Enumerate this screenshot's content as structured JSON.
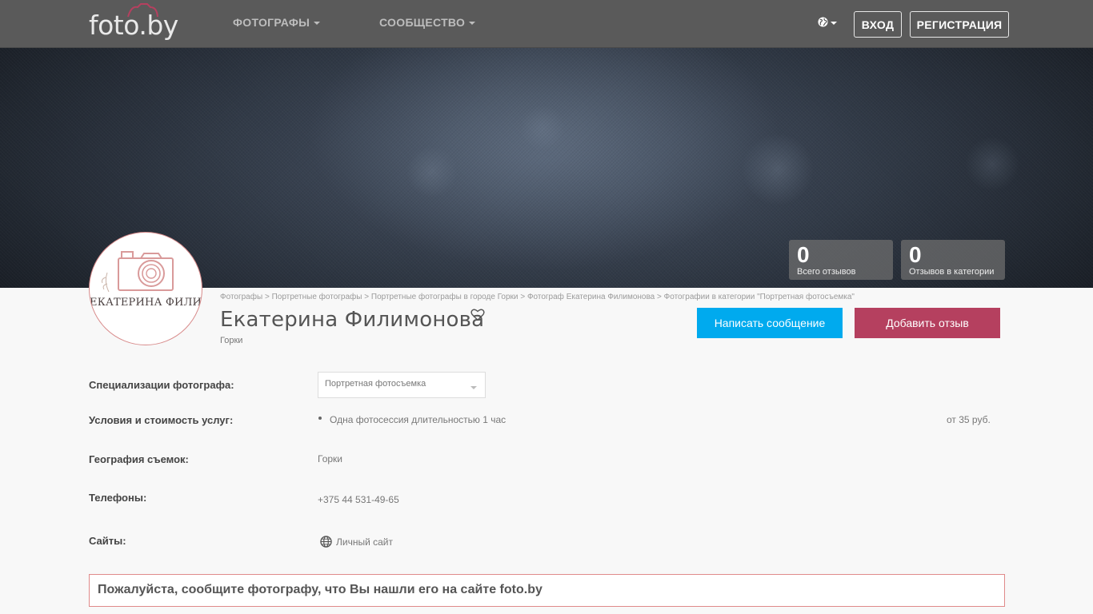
{
  "header": {
    "logo_text": "foto.by",
    "nav": [
      {
        "label": "ФОТОГРАФЫ"
      },
      {
        "label": "СООБЩЕСТВО"
      }
    ],
    "login_label": "ВХОД",
    "register_label": "РЕГИСТРАЦИЯ"
  },
  "stats": [
    {
      "value": "0",
      "label": "Всего отзывов"
    },
    {
      "value": "0",
      "label": "Отзывов в категории"
    }
  ],
  "avatar": {
    "text": "ЕКАТЕРИНА ФИЛИМОНОВА"
  },
  "breadcrumb": [
    "Фотографы",
    "Портретные фотографы",
    "Портретные фотографы в городе Горки",
    "Фотограф Екатерина Филимонова",
    "Фотографии в категории \"Портретная фотосъемка\""
  ],
  "profile": {
    "name": "Екатерина Филимонова",
    "city": "Горки",
    "message_button": "Написать сообщение",
    "review_button": "Добавить отзыв"
  },
  "info": {
    "specializations_label": "Специализации фотографа:",
    "specialization_selected": "Портретная фотосъемка",
    "services_label": "Условия и стоимость услуг:",
    "service_name": "Одна фотосессия длительностью 1 час",
    "service_price": "от 35 руб.",
    "geography_label": "География съемок:",
    "geography_value": "Горки",
    "phones_label": "Телефоны:",
    "phone_value": "+375 44 531-49-65",
    "sites_label": "Сайты:",
    "site_link": "Личный сайт"
  },
  "notice": "Пожалуйста, сообщите фотографу, что Вы нашли его на сайте foto.by",
  "colors": {
    "nav_bg": "#5a5a5a",
    "primary_blue": "#00aaee",
    "rose": "#b5405f",
    "notice_border": "#e08a8a"
  }
}
